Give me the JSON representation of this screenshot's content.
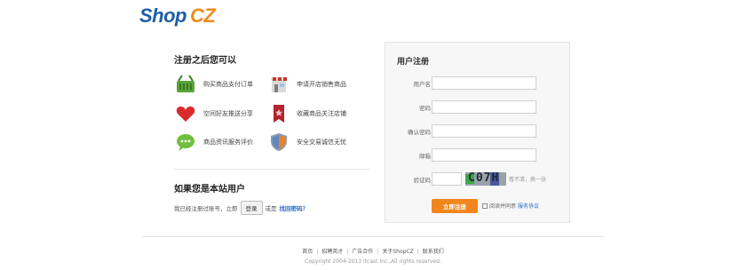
{
  "header": {
    "logo_shop": "Shop",
    "logo_cz": "CZ"
  },
  "benefits": {
    "title": "注册之后您可以",
    "items": [
      {
        "icon": "basket-icon",
        "text": "购买商品支付订单"
      },
      {
        "icon": "store-icon",
        "text": "申请开店销售商品"
      },
      {
        "icon": "heart-icon",
        "text": "空间好友推送分享"
      },
      {
        "icon": "bookmark-icon",
        "text": "收藏商品关注店铺"
      },
      {
        "icon": "chat-icon",
        "text": "商品资讯服务评价"
      },
      {
        "icon": "shield-icon",
        "text": "安全交易诚信无忧"
      }
    ]
  },
  "member": {
    "title": "如果您是本站用户",
    "prefix": "我已经注册过账号，立即",
    "login_button": "登录",
    "middle": "或是",
    "forgot_link": "找回密码？"
  },
  "register": {
    "title": "用户注册",
    "fields": {
      "username": {
        "label": "用户名",
        "value": ""
      },
      "password": {
        "label": "密码",
        "value": ""
      },
      "confirm": {
        "label": "确认密码",
        "value": ""
      },
      "email": {
        "label": "邮箱",
        "value": ""
      },
      "captcha": {
        "label": "验证码",
        "value": ""
      }
    },
    "captcha_image_text": "C07H",
    "captcha_hint": "看不清，换一张",
    "submit_button": "立即注册",
    "agree_text": "阅读并同意",
    "agree_link": "服务协议",
    "colors": {
      "submit": "#f0861d",
      "link": "#2b6cc4"
    }
  },
  "footer": {
    "links": [
      "首页",
      "招聘英才",
      "广告合作",
      "关于ShopCZ",
      "联系我们"
    ],
    "copyright": "Copyright 2004-2013 itcast Inc.,All rights reserved."
  }
}
